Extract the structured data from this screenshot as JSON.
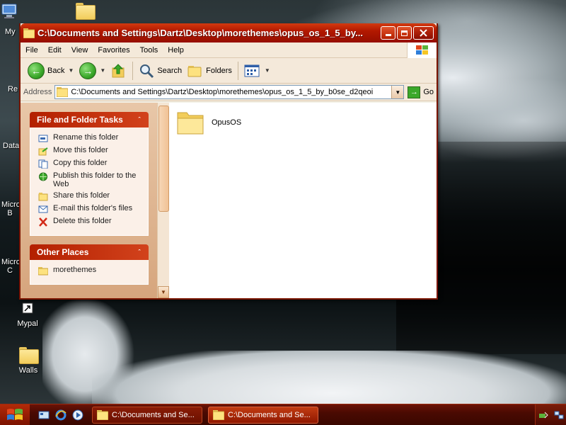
{
  "desktop": {
    "icons": [
      {
        "label": "My",
        "icon": "computer-icon"
      },
      {
        "label": "",
        "icon": "folder-icon"
      },
      {
        "label": "Re",
        "icon": "recycle-bin-icon"
      },
      {
        "label": "Data",
        "icon": "folder-icon"
      },
      {
        "label": "Micro\nB",
        "icon": "app-icon"
      },
      {
        "label": "Micro\nC",
        "icon": "app-icon"
      },
      {
        "label": "Mypal",
        "icon": "shortcut-icon"
      },
      {
        "label": "Walls",
        "icon": "folder-icon"
      }
    ]
  },
  "window": {
    "title": "C:\\Documents and Settings\\Dartz\\Desktop\\morethemes\\opus_os_1_5_by...",
    "menu": [
      "File",
      "Edit",
      "View",
      "Favorites",
      "Tools",
      "Help"
    ],
    "toolbar": {
      "back": "Back",
      "search": "Search",
      "folders": "Folders"
    },
    "address": {
      "label": "Address",
      "value": "C:\\Documents and Settings\\Dartz\\Desktop\\morethemes\\opus_os_1_5_by_b0se_d2qeoi",
      "go": "Go"
    },
    "tasks_panel": {
      "title": "File and Folder Tasks",
      "items": [
        {
          "label": "Rename this folder",
          "icon": "rename-icon"
        },
        {
          "label": "Move this folder",
          "icon": "move-icon"
        },
        {
          "label": "Copy this folder",
          "icon": "copy-icon"
        },
        {
          "label": "Publish this folder to the Web",
          "icon": "publish-web-icon"
        },
        {
          "label": "Share this folder",
          "icon": "share-icon"
        },
        {
          "label": "E-mail this folder's files",
          "icon": "email-icon"
        },
        {
          "label": "Delete this folder",
          "icon": "delete-icon"
        }
      ]
    },
    "places_panel": {
      "title": "Other Places",
      "items": [
        {
          "label": "morethemes",
          "icon": "folder-icon"
        }
      ]
    },
    "files": [
      {
        "name": "OpusOS",
        "icon": "folder-icon"
      }
    ]
  },
  "taskbar": {
    "buttons": [
      {
        "label": "C:\\Documents and Se..."
      },
      {
        "label": "C:\\Documents and Se..."
      }
    ]
  },
  "colors": {
    "title_red": "#b21800",
    "panel_head": "#c32e0a",
    "taskbar": "#4a0a02"
  }
}
